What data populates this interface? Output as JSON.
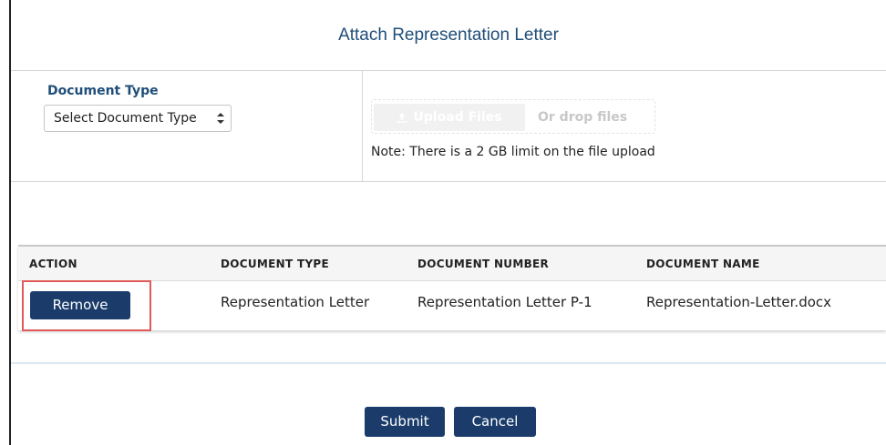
{
  "dialog": {
    "title": "Attach Representation Letter"
  },
  "upload": {
    "doc_type_label": "Document Type",
    "doc_type_selected": "Select Document Type",
    "upload_button_label": "Upload Files",
    "drop_text": "Or drop files",
    "note": "Note: There is a 2 GB limit on the file upload"
  },
  "table": {
    "headers": [
      "ACTION",
      "DOCUMENT TYPE",
      "DOCUMENT NUMBER",
      "DOCUMENT NAME"
    ],
    "rows": [
      {
        "action_label": "Remove",
        "document_type": "Representation Letter",
        "document_number": "Representation Letter P-1",
        "document_name": "Representation-Letter.docx"
      }
    ]
  },
  "footer": {
    "submit_label": "Submit",
    "cancel_label": "Cancel"
  },
  "icons": {
    "upload": "upload-icon",
    "spinner": "select-spinner-icon"
  },
  "colors": {
    "title": "#1f4e79",
    "button": "#1b3c6b",
    "highlight": "#e05a5a"
  }
}
